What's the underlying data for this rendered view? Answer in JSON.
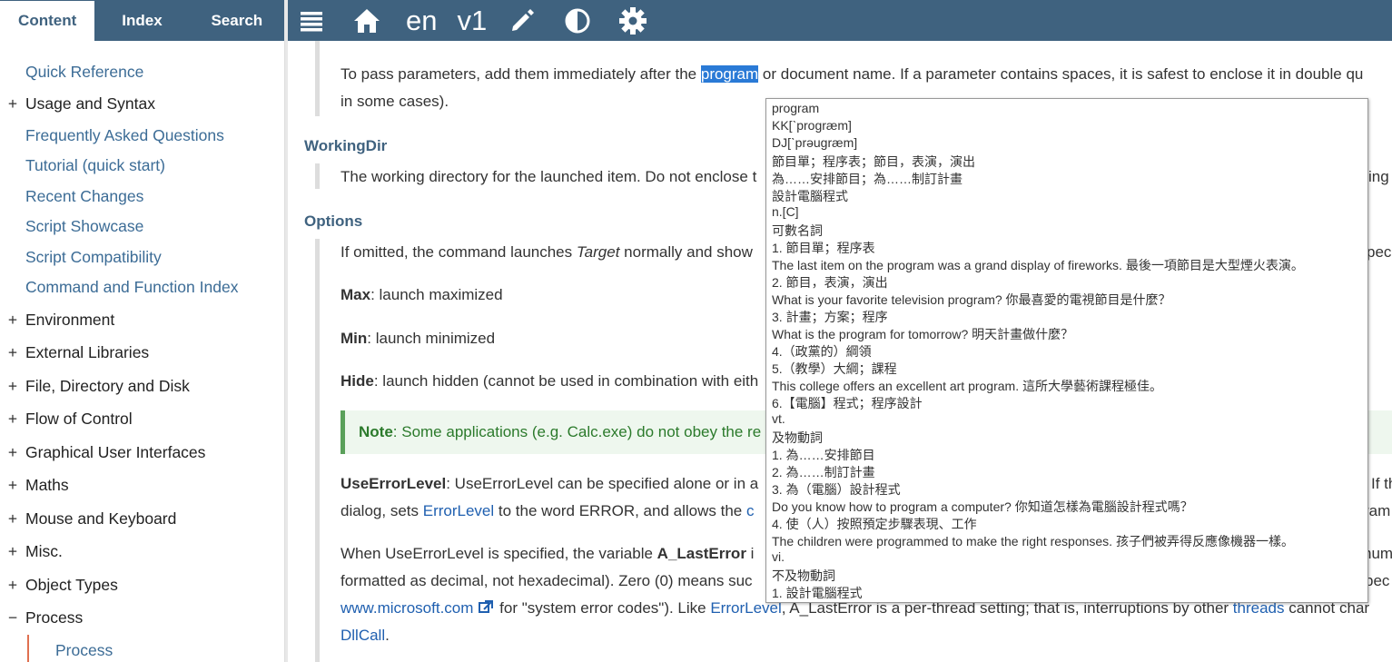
{
  "tabs": [
    "Content",
    "Index",
    "Search"
  ],
  "topbar": {
    "lang": "en",
    "version": "v1"
  },
  "sidebar": {
    "items": [
      {
        "pm": "",
        "label": "Quick Reference",
        "link": true
      },
      {
        "pm": "+",
        "label": "Usage and Syntax",
        "link": false
      },
      {
        "pm": "",
        "label": "Frequently Asked Questions",
        "link": true
      },
      {
        "pm": "",
        "label": "Tutorial (quick start)",
        "link": true
      },
      {
        "pm": "",
        "label": "Recent Changes",
        "link": true
      },
      {
        "pm": "",
        "label": "Script Showcase",
        "link": true
      },
      {
        "pm": "",
        "label": "Script Compatibility",
        "link": true
      },
      {
        "pm": "",
        "label": "Command and Function Index",
        "link": true
      },
      {
        "pm": "+",
        "label": "Environment",
        "link": false
      },
      {
        "pm": "+",
        "label": "External Libraries",
        "link": false
      },
      {
        "pm": "+",
        "label": "File, Directory and Disk",
        "link": false
      },
      {
        "pm": "+",
        "label": "Flow of Control",
        "link": false
      },
      {
        "pm": "+",
        "label": "Graphical User Interfaces",
        "link": false
      },
      {
        "pm": "+",
        "label": "Maths",
        "link": false
      },
      {
        "pm": "+",
        "label": "Mouse and Keyboard",
        "link": false
      },
      {
        "pm": "+",
        "label": "Misc.",
        "link": false
      },
      {
        "pm": "+",
        "label": "Object Types",
        "link": false
      },
      {
        "pm": "−",
        "label": "Process",
        "link": false
      }
    ],
    "sub_item": "Process"
  },
  "main": {
    "params_1a": "To pass parameters, add them immediately after the ",
    "params_hl": "program",
    "params_1b": " or document name. If a parameter contains spaces, it is safest to enclose it in double qu",
    "params_2": "in some cases).",
    "workingdir_h": "WorkingDir",
    "workingdir_p": "The working directory for the launched item. Do not enclose t",
    "workingdir_tail": "ing c",
    "options_h": "Options",
    "options_p_a": "If omitted, the command launches ",
    "options_p_i": "Target",
    "options_p_b": " normally and show",
    "options_tail": "pec",
    "max_b": "Max",
    "max_t": ": launch maximized",
    "min_b": "Min",
    "min_t": ": launch minimized",
    "hide_b": "Hide",
    "hide_t": ": launch hidden (cannot be used in combination with eith",
    "note_b": "Note",
    "note_t": ": Some applications (e.g. Calc.exe) do not obey the re",
    "uel_b": "UseErrorLevel",
    "uel_t": ": UseErrorLevel can be specified alone or in a",
    "uel_tail": "If th",
    "dialog_a": "dialog, sets ",
    "dialog_link": "ErrorLevel",
    "dialog_b": " to the word ERROR, and allows the ",
    "dialog_c": "c",
    "dialog_tail": "ram",
    "when_a": "When UseErrorLevel is specified, the variable ",
    "when_b": "A_LastError",
    "when_c": " i",
    "when_tail": "num",
    "fmt_a": "formatted as decimal, not hexadecimal). Zero (0) means suc",
    "fmt_tail": "pec",
    "ms_link": "www.microsoft.com",
    "ms_b": " for \"system error codes\"). Like ",
    "ms_link2": "ErrorLevel",
    "ms_c": ", A_LastError is a per-thread setting; that is, interruptions by other ",
    "ms_link3": "threads",
    "ms_d": " cannot char",
    "dllcall": "DllCall",
    "dllcall_end": "."
  },
  "popup": {
    "lines": [
      "program",
      "KK[ˋprogræm]",
      "DJ[ˋprəugræm]",
      "節目單；程序表；節目，表演，演出",
      "為……安排節目；為……制訂計畫",
      "設計電腦程式",
      "n.[C]",
      "可數名詞",
      "1. 節目單；程序表",
      "The last item on the program was a grand display of fireworks. 最後一項節目是大型煙火表演。",
      "2. 節目，表演，演出",
      "What is your favorite television program? 你最喜愛的電視節目是什麼？",
      "3. 計畫；方案；程序",
      "What is the program for tomorrow? 明天計畫做什麼？",
      "4.（政黨的）綱領",
      "5.（教學）大綱；課程",
      "This college offers an excellent art program. 這所大學藝術課程極佳。",
      "6.【電腦】程式；程序設計",
      "vt.",
      "及物動詞",
      "1. 為……安排節目",
      "2. 為……制訂計畫",
      "3. 為（電腦）設計程式",
      "Do you know how to program a computer? 你知道怎樣為電腦設計程式嗎？",
      "4. 使（人）按照預定步驟表現、工作",
      "The children were programmed to make the right responses. 孩子們被弄得反應像機器一樣。",
      "vi.",
      "不及物動詞",
      "1. 設計電腦程式"
    ]
  }
}
